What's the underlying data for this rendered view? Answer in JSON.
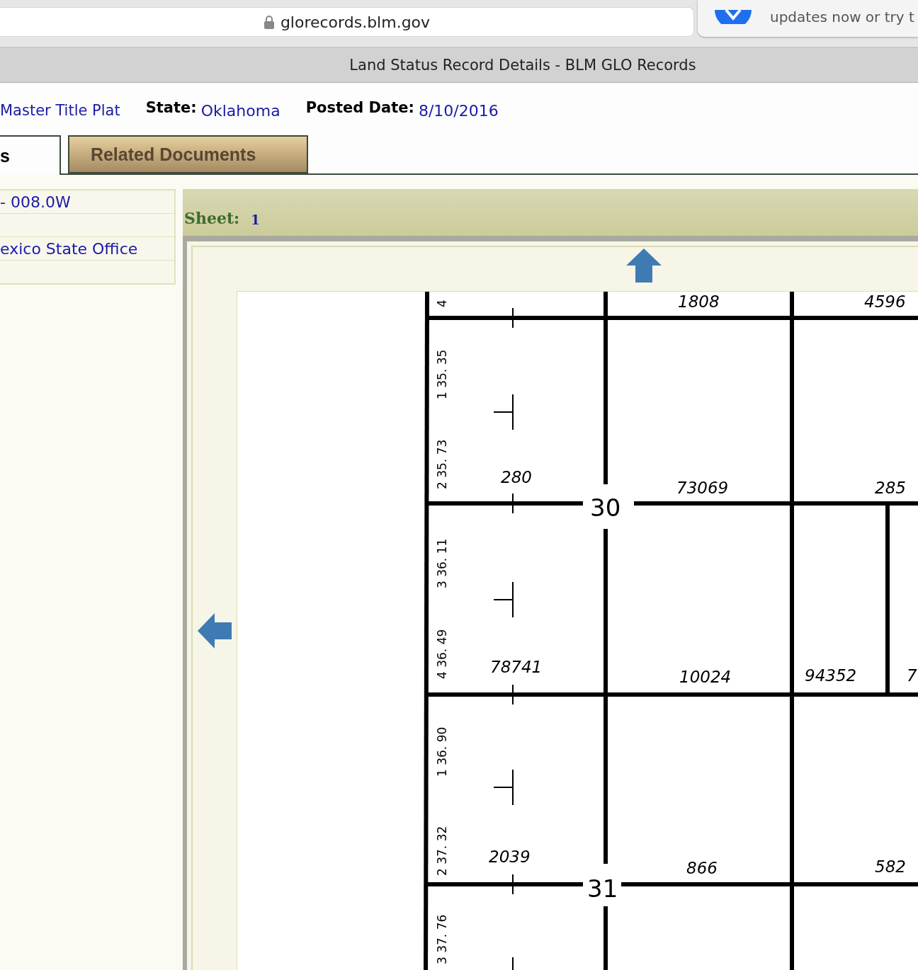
{
  "browser": {
    "address": "glorecords.blm.gov",
    "notification": "updates now or try t",
    "title": "Land Status Record Details - BLM GLO Records"
  },
  "header": {
    "document_link": "Master Title Plat",
    "state_label": "State:",
    "state_value": "Oklahoma",
    "date_label": "Posted Date:",
    "date_value": "8/10/2016"
  },
  "tabs": [
    {
      "label": "s",
      "selected": true
    },
    {
      "label": "Related Documents",
      "selected": false
    }
  ],
  "details": {
    "rows": [
      {
        "value": "- 008.0W"
      },
      {},
      {
        "value": "exico State Office"
      },
      {}
    ]
  },
  "sheet": {
    "label": "Sheet:",
    "value": "1"
  },
  "plat": {
    "labels": [
      "4",
      "1 35. 35",
      "2 35. 73",
      "3 36. 11",
      "4 36. 49",
      "1 36. 90",
      "2 37. 32",
      "3 37. 76",
      "1808",
      "4596",
      "280",
      "73069",
      "285",
      "30",
      "78741",
      "10024",
      "94352",
      "7",
      "2039",
      "866",
      "582",
      "31"
    ]
  }
}
